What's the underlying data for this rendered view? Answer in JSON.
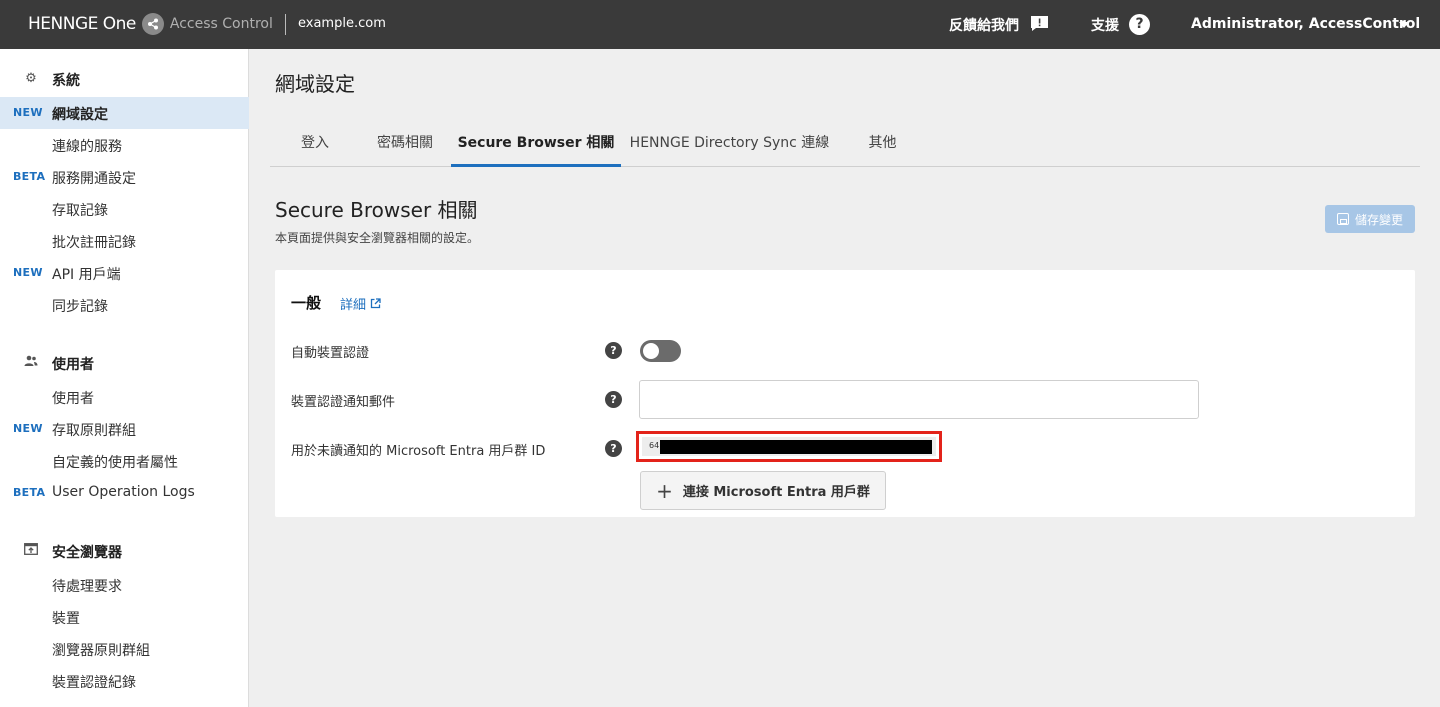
{
  "header": {
    "brand_name": "HENNGE One",
    "brand_product": "Access Control",
    "tenant": "example.com",
    "feedback_label": "反饋給我們",
    "support_label": "支援",
    "user_name": "Administrator, AccessControl"
  },
  "sidebar": {
    "items": [
      {
        "tag": "",
        "label": "系統",
        "icon": "gear-icon",
        "header": true
      },
      {
        "tag": "NEW",
        "label": "網域設定",
        "active": true
      },
      {
        "tag": "",
        "label": "連線的服務"
      },
      {
        "tag": "BETA",
        "label": "服務開通設定"
      },
      {
        "tag": "",
        "label": "存取記錄"
      },
      {
        "tag": "",
        "label": "批次註冊記錄"
      },
      {
        "tag": "NEW",
        "label": "API 用戶端"
      },
      {
        "tag": "",
        "label": "同步記錄"
      },
      {
        "tag": "",
        "label": "使用者",
        "icon": "users-icon",
        "header": true
      },
      {
        "tag": "",
        "label": "使用者"
      },
      {
        "tag": "NEW",
        "label": "存取原則群組"
      },
      {
        "tag": "",
        "label": "自定義的使用者屬性"
      },
      {
        "tag": "BETA",
        "label": "User Operation Logs"
      },
      {
        "tag": "",
        "label": "安全瀏覽器",
        "icon": "browser-icon",
        "header": true
      },
      {
        "tag": "",
        "label": "待處理要求"
      },
      {
        "tag": "",
        "label": "裝置"
      },
      {
        "tag": "",
        "label": "瀏覽器原則群組"
      },
      {
        "tag": "",
        "label": "裝置認證紀錄"
      }
    ]
  },
  "main": {
    "page_title": "網域設定",
    "tabs": [
      "登入",
      "密碼相關",
      "Secure Browser 相關",
      "HENNGE Directory Sync 連線",
      "其他"
    ],
    "active_tab": 2,
    "section_title": "Secure Browser 相關",
    "section_desc": "本頁面提供與安全瀏覽器相關的設定。",
    "save_label": "儲存變更",
    "card": {
      "heading": "一般",
      "details_link": "詳細",
      "fields": {
        "auto_auth_label": "自動裝置認證",
        "auto_auth_enabled": false,
        "email_label": "裝置認證通知郵件",
        "email_value": "",
        "group_id_label": "用於未讀通知的 Microsoft Entra 用戶群 ID",
        "group_id_prefix": "64"
      },
      "connect_label": "連接 Microsoft Entra 用戶群"
    }
  },
  "colors": {
    "accent": "#1d6fbe",
    "topbar": "#3a3a3a",
    "highlight_border": "#e3231a",
    "save_disabled": "#a7c6e6"
  }
}
